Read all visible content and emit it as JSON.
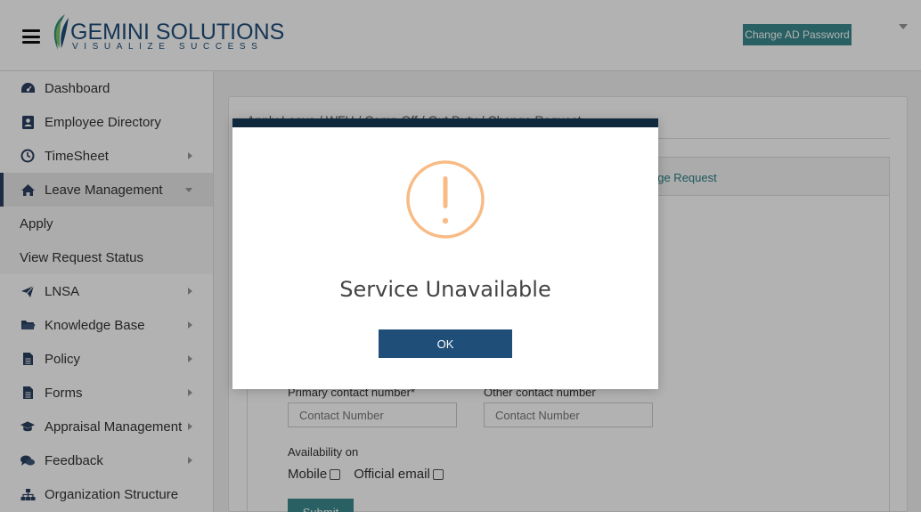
{
  "header": {
    "logo_name": "GEMINI SOLUTIONS",
    "logo_tagline": "VISUALIZE SUCCESS",
    "change_password_label": "Change AD Password"
  },
  "sidebar": {
    "items": [
      {
        "label": "Dashboard",
        "icon": "dashboard-icon"
      },
      {
        "label": "Employee Directory",
        "icon": "directory-icon"
      },
      {
        "label": "TimeSheet",
        "icon": "clock-icon"
      },
      {
        "label": "Leave Management",
        "icon": "home-icon"
      },
      {
        "label": "LNSA",
        "icon": "send-icon"
      },
      {
        "label": "Knowledge Base",
        "icon": "folder-icon"
      },
      {
        "label": "Policy",
        "icon": "file-icon"
      },
      {
        "label": "Forms",
        "icon": "file-icon"
      },
      {
        "label": "Appraisal Management",
        "icon": "graduation-cap-icon"
      },
      {
        "label": "Feedback",
        "icon": "comments-icon"
      },
      {
        "label": "Organization Structure",
        "icon": "sitemap-icon"
      }
    ],
    "sub_items": [
      {
        "label": "Apply"
      },
      {
        "label": "View Request Status"
      }
    ]
  },
  "main": {
    "title": "Apply Leave / WFH / Comp Off / Out Duty / Change Request",
    "tab_visible_label": "nge Request",
    "primary_contact_label": "Primary contact number*",
    "primary_contact_placeholder": "Contact Number",
    "other_contact_label": "Other contact number",
    "other_contact_placeholder": "Contact Number",
    "availability_label": "Availability on",
    "mobile_label": "Mobile",
    "official_email_label": "Official email",
    "submit_label": "Submit"
  },
  "modal": {
    "title": "Service Unavailable",
    "ok_label": "OK",
    "icon": "warning-icon",
    "icon_color": "#f8bb86",
    "bar_color": "#10293d"
  },
  "colors": {
    "primary": "#1f4e79",
    "accent": "#3a8a8e"
  }
}
